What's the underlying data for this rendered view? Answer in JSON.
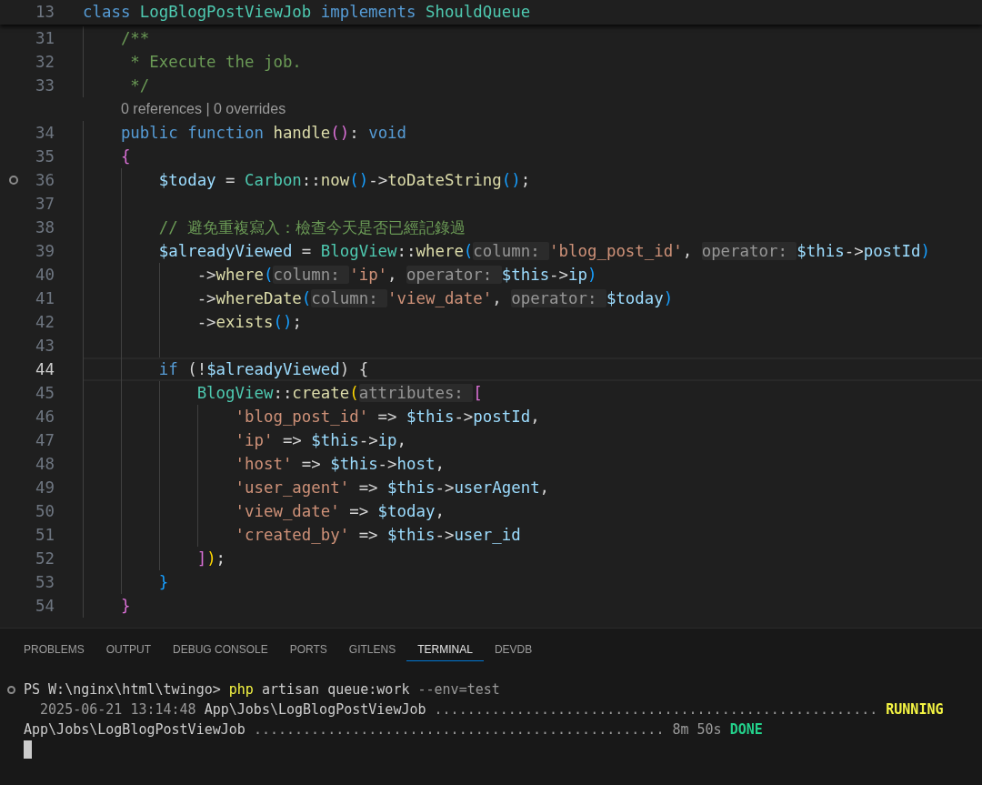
{
  "editor": {
    "sticky_line": {
      "number": "13",
      "tokens": [
        {
          "kind": "keyword",
          "text": "class "
        },
        {
          "kind": "type",
          "text": "LogBlogPostViewJob "
        },
        {
          "kind": "keyword",
          "text": "implements "
        },
        {
          "kind": "type",
          "text": "ShouldQueue"
        }
      ]
    },
    "lines": [
      {
        "kind": "code",
        "number": "31",
        "current": false,
        "marker": false,
        "tokens": [
          {
            "kind": "comment",
            "text": "    /**"
          }
        ]
      },
      {
        "kind": "code",
        "number": "32",
        "current": false,
        "marker": false,
        "tokens": [
          {
            "kind": "comment",
            "text": "     * Execute the job."
          }
        ]
      },
      {
        "kind": "code",
        "number": "33",
        "current": false,
        "marker": false,
        "tokens": [
          {
            "kind": "comment",
            "text": "     */"
          }
        ]
      },
      {
        "kind": "codelens",
        "text": "0 references | 0 overrides"
      },
      {
        "kind": "code",
        "number": "34",
        "current": false,
        "marker": false,
        "tokens": [
          {
            "kind": "keyword",
            "text": "    public function "
          },
          {
            "kind": "function",
            "text": "handle"
          },
          {
            "kind": "bracket2",
            "text": "()"
          },
          {
            "kind": "plain",
            "text": ": "
          },
          {
            "kind": "keyword",
            "text": "void"
          }
        ]
      },
      {
        "kind": "code",
        "number": "35",
        "current": false,
        "marker": false,
        "tokens": [
          {
            "kind": "bracket2",
            "text": "    {"
          }
        ]
      },
      {
        "kind": "code",
        "number": "36",
        "current": false,
        "marker": true,
        "tokens": [
          {
            "kind": "variable",
            "text": "        $today"
          },
          {
            "kind": "plain",
            "text": " = "
          },
          {
            "kind": "type",
            "text": "Carbon"
          },
          {
            "kind": "plain",
            "text": "::"
          },
          {
            "kind": "function",
            "text": "now"
          },
          {
            "kind": "bracket3",
            "text": "()"
          },
          {
            "kind": "plain",
            "text": "->"
          },
          {
            "kind": "function",
            "text": "toDateString"
          },
          {
            "kind": "bracket3",
            "text": "()"
          },
          {
            "kind": "plain",
            "text": ";"
          }
        ]
      },
      {
        "kind": "code",
        "number": "37",
        "current": false,
        "marker": false
      },
      {
        "kind": "code",
        "number": "38",
        "current": false,
        "marker": false,
        "tokens": [
          {
            "kind": "comment",
            "text": "        // 避免重複寫入：檢查今天是否已經記錄過"
          }
        ]
      },
      {
        "kind": "code",
        "number": "39",
        "current": false,
        "marker": false,
        "tokens": [
          {
            "kind": "variable",
            "text": "        $alreadyViewed"
          },
          {
            "kind": "plain",
            "text": " = "
          },
          {
            "kind": "type",
            "text": "BlogView"
          },
          {
            "kind": "plain",
            "text": "::"
          },
          {
            "kind": "function",
            "text": "where"
          },
          {
            "kind": "bracket3",
            "text": "("
          },
          {
            "kind": "hint",
            "text": "column: "
          },
          {
            "kind": "string",
            "text": "'blog_post_id'"
          },
          {
            "kind": "plain",
            "text": ", "
          },
          {
            "kind": "hint",
            "text": "operator: "
          },
          {
            "kind": "variable",
            "text": "$this"
          },
          {
            "kind": "plain",
            "text": "->"
          },
          {
            "kind": "variable",
            "text": "postId"
          },
          {
            "kind": "bracket3",
            "text": ")"
          }
        ]
      },
      {
        "kind": "code",
        "number": "40",
        "current": false,
        "marker": false,
        "tokens": [
          {
            "kind": "plain",
            "text": "            ->"
          },
          {
            "kind": "function",
            "text": "where"
          },
          {
            "kind": "bracket3",
            "text": "("
          },
          {
            "kind": "hint",
            "text": "column: "
          },
          {
            "kind": "string",
            "text": "'ip'"
          },
          {
            "kind": "plain",
            "text": ", "
          },
          {
            "kind": "hint",
            "text": "operator: "
          },
          {
            "kind": "variable",
            "text": "$this"
          },
          {
            "kind": "plain",
            "text": "->"
          },
          {
            "kind": "variable",
            "text": "ip"
          },
          {
            "kind": "bracket3",
            "text": ")"
          }
        ]
      },
      {
        "kind": "code",
        "number": "41",
        "current": false,
        "marker": false,
        "tokens": [
          {
            "kind": "plain",
            "text": "            ->"
          },
          {
            "kind": "function",
            "text": "whereDate"
          },
          {
            "kind": "bracket3",
            "text": "("
          },
          {
            "kind": "hint",
            "text": "column: "
          },
          {
            "kind": "string",
            "text": "'view_date'"
          },
          {
            "kind": "plain",
            "text": ", "
          },
          {
            "kind": "hint",
            "text": "operator: "
          },
          {
            "kind": "variable",
            "text": "$today"
          },
          {
            "kind": "bracket3",
            "text": ")"
          }
        ]
      },
      {
        "kind": "code",
        "number": "42",
        "current": false,
        "marker": false,
        "tokens": [
          {
            "kind": "plain",
            "text": "            ->"
          },
          {
            "kind": "function",
            "text": "exists"
          },
          {
            "kind": "bracket3",
            "text": "()"
          },
          {
            "kind": "plain",
            "text": ";"
          }
        ]
      },
      {
        "kind": "code",
        "number": "43",
        "current": false,
        "marker": false
      },
      {
        "kind": "code",
        "number": "44",
        "current": true,
        "marker": false,
        "tokens": [
          {
            "kind": "keyword",
            "text": "        if"
          },
          {
            "kind": "plain",
            "text": " (!"
          },
          {
            "kind": "variable",
            "text": "$alreadyViewed"
          },
          {
            "kind": "plain",
            "text": ") {"
          }
        ]
      },
      {
        "kind": "code",
        "number": "45",
        "current": false,
        "marker": false,
        "tokens": [
          {
            "kind": "type",
            "text": "            BlogView"
          },
          {
            "kind": "plain",
            "text": "::"
          },
          {
            "kind": "function",
            "text": "create"
          },
          {
            "kind": "bracket1",
            "text": "("
          },
          {
            "kind": "hint",
            "text": "attributes: "
          },
          {
            "kind": "bracket2",
            "text": "["
          }
        ]
      },
      {
        "kind": "code",
        "number": "46",
        "current": false,
        "marker": false,
        "tokens": [
          {
            "kind": "string",
            "text": "                'blog_post_id'"
          },
          {
            "kind": "plain",
            "text": " => "
          },
          {
            "kind": "variable",
            "text": "$this"
          },
          {
            "kind": "plain",
            "text": "->"
          },
          {
            "kind": "variable",
            "text": "postId"
          },
          {
            "kind": "plain",
            "text": ","
          }
        ]
      },
      {
        "kind": "code",
        "number": "47",
        "current": false,
        "marker": false,
        "tokens": [
          {
            "kind": "string",
            "text": "                'ip'"
          },
          {
            "kind": "plain",
            "text": " => "
          },
          {
            "kind": "variable",
            "text": "$this"
          },
          {
            "kind": "plain",
            "text": "->"
          },
          {
            "kind": "variable",
            "text": "ip"
          },
          {
            "kind": "plain",
            "text": ","
          }
        ]
      },
      {
        "kind": "code",
        "number": "48",
        "current": false,
        "marker": false,
        "tokens": [
          {
            "kind": "string",
            "text": "                'host'"
          },
          {
            "kind": "plain",
            "text": " => "
          },
          {
            "kind": "variable",
            "text": "$this"
          },
          {
            "kind": "plain",
            "text": "->"
          },
          {
            "kind": "variable",
            "text": "host"
          },
          {
            "kind": "plain",
            "text": ","
          }
        ]
      },
      {
        "kind": "code",
        "number": "49",
        "current": false,
        "marker": false,
        "tokens": [
          {
            "kind": "string",
            "text": "                'user_agent'"
          },
          {
            "kind": "plain",
            "text": " => "
          },
          {
            "kind": "variable",
            "text": "$this"
          },
          {
            "kind": "plain",
            "text": "->"
          },
          {
            "kind": "variable",
            "text": "userAgent"
          },
          {
            "kind": "plain",
            "text": ","
          }
        ]
      },
      {
        "kind": "code",
        "number": "50",
        "current": false,
        "marker": false,
        "tokens": [
          {
            "kind": "string",
            "text": "                'view_date'"
          },
          {
            "kind": "plain",
            "text": " => "
          },
          {
            "kind": "variable",
            "text": "$today"
          },
          {
            "kind": "plain",
            "text": ","
          }
        ]
      },
      {
        "kind": "code",
        "number": "51",
        "current": false,
        "marker": false,
        "tokens": [
          {
            "kind": "string",
            "text": "                'created_by'"
          },
          {
            "kind": "plain",
            "text": " => "
          },
          {
            "kind": "variable",
            "text": "$this"
          },
          {
            "kind": "plain",
            "text": "->"
          },
          {
            "kind": "variable",
            "text": "user_id"
          }
        ]
      },
      {
        "kind": "code",
        "number": "52",
        "current": false,
        "marker": false,
        "tokens": [
          {
            "kind": "bracket2",
            "text": "            ]"
          },
          {
            "kind": "bracket1",
            "text": ")"
          },
          {
            "kind": "plain",
            "text": ";"
          }
        ]
      },
      {
        "kind": "code",
        "number": "53",
        "current": false,
        "marker": false,
        "tokens": [
          {
            "kind": "bracket3",
            "text": "        }"
          }
        ]
      },
      {
        "kind": "code",
        "number": "54",
        "current": false,
        "marker": false,
        "tokens": [
          {
            "kind": "bracket2",
            "text": "    }"
          }
        ]
      }
    ]
  },
  "panel": {
    "tabs": [
      {
        "label": "PROBLEMS",
        "selected": false
      },
      {
        "label": "OUTPUT",
        "selected": false
      },
      {
        "label": "DEBUG CONSOLE",
        "selected": false
      },
      {
        "label": "PORTS",
        "selected": false
      },
      {
        "label": "GITLENS",
        "selected": false
      },
      {
        "label": "TERMINAL",
        "selected": true
      },
      {
        "label": "DEVDB",
        "selected": false
      }
    ],
    "terminal": {
      "cursor": true,
      "lines": [
        {
          "marker": true,
          "tokens": [
            {
              "kind": "plain",
              "text": "PS W:\\nginx\\html\\twingo> "
            },
            {
              "kind": "command",
              "text": "php"
            },
            {
              "kind": "plain",
              "text": " artisan queue:work "
            },
            {
              "kind": "dim",
              "text": "--env=test"
            }
          ]
        },
        {
          "marker": false,
          "tokens": [
            {
              "kind": "dim",
              "text": "  2025-06-21 13:14:48 "
            },
            {
              "kind": "plain",
              "text": "App\\Jobs\\LogBlogPostViewJob "
            },
            {
              "kind": "dim",
              "text": "...................................................... "
            },
            {
              "kind": "running",
              "text": "RUNNING"
            }
          ]
        },
        {
          "marker": false,
          "tokens": [
            {
              "kind": "plain",
              "text": "App\\Jobs\\LogBlogPostViewJob "
            },
            {
              "kind": "dim",
              "text": ".................................................. 8m 50s "
            },
            {
              "kind": "done",
              "text": "DONE"
            }
          ]
        }
      ]
    }
  }
}
